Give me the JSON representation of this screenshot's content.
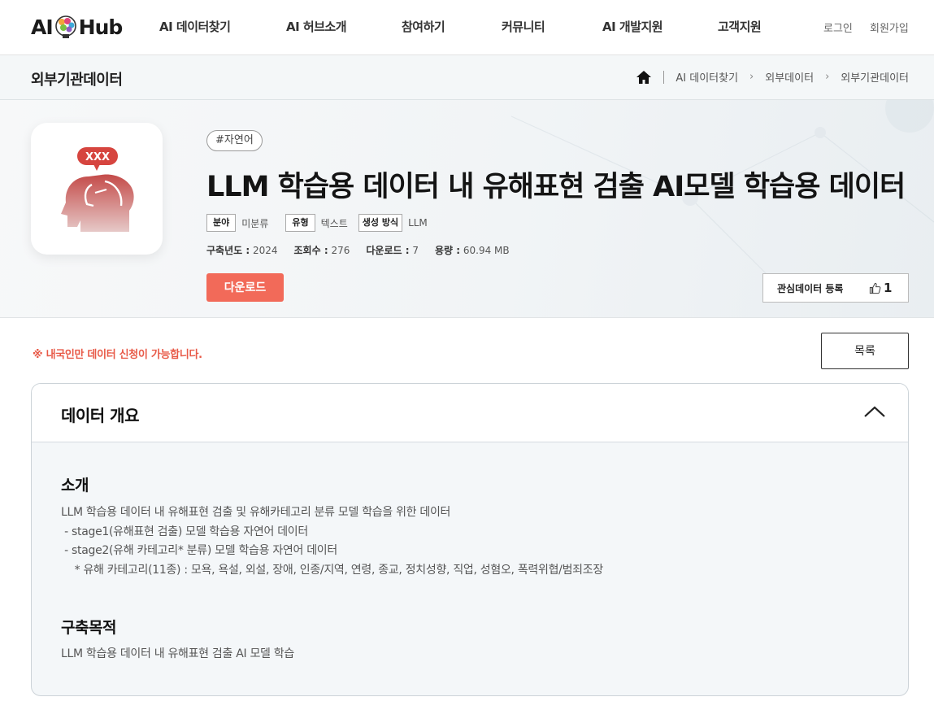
{
  "header": {
    "logo_left": "AI",
    "logo_right": "Hub",
    "menu": [
      "AI 데이터찾기",
      "AI 허브소개",
      "참여하기",
      "커뮤니티",
      "AI 개발지원",
      "고객지원"
    ],
    "login": "로그인",
    "signup": "회원가입"
  },
  "subbar": {
    "title": "외부기관데이터",
    "breadcrumb": [
      "AI 데이터찾기",
      "외부데이터",
      "외부기관데이터"
    ]
  },
  "dataset": {
    "tag": "#자연어",
    "title": "LLM 학습용 데이터 내 유해표현 검출 AI모델 학습용 데이터",
    "thumb_text": "XXX",
    "meta": [
      {
        "label": "분야",
        "value": "미분류"
      },
      {
        "label": "유형",
        "value": "텍스트"
      },
      {
        "label": "생성 방식",
        "value": "LLM"
      }
    ],
    "stats": {
      "year_label": "구축년도 :",
      "year": "2024",
      "views_label": "조회수 :",
      "views": "276",
      "downloads_label": "다운로드 :",
      "downloads": "7",
      "size_label": "용량 :",
      "size": "60.94 MB"
    },
    "download_label": "다운로드",
    "favorite_label": "관심데이터 등록",
    "like_count": "1"
  },
  "notice": "※ 내국인만 데이터 신청이 가능합니다.",
  "list_button": "목록",
  "overview": {
    "title": "데이터 개요",
    "intro_title": "소개",
    "intro_lines": [
      "LLM 학습용 데이터 내 유해표현 검출 및 유해카테고리 분류 모델 학습을 위한 데이터",
      " - stage1(유해표현 검출) 모델 학습용 자연어 데이터",
      " - stage2(유해 카테고리* 분류) 모델 학습용 자연어 데이터",
      "    * 유해 카테고리(11종) : 모욕, 욕설, 외설, 장애, 인종/지역, 연령, 종교, 정치성향, 직업, 성혐오, 폭력위협/범죄조장"
    ],
    "purpose_title": "구축목적",
    "purpose_text": "LLM 학습용 데이터 내 유해표현 검출 AI 모델 학습"
  },
  "colors": {
    "accent": "#f26a59",
    "notice": "#e85a48",
    "icon_red": "#b8413f"
  }
}
